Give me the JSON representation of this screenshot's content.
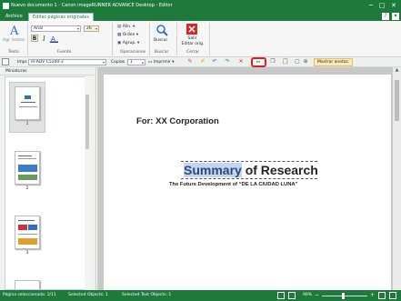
{
  "window": {
    "title": "Nuevo documento 1 - Canon imageRUNNER ADVANCE Desktop - Editor",
    "buttons": {
      "minimize": "─",
      "maximize": "□",
      "close": "✕"
    }
  },
  "tabs": [
    {
      "label": "Archivo"
    },
    {
      "label": "Editar páginas originales"
    }
  ],
  "ribbon": {
    "text_group": {
      "add_text_label": "Agr. textos",
      "group_label": "Texto"
    },
    "font_group": {
      "font_name": "Arial",
      "font_size": "26",
      "bold": "B",
      "group_label": "Fuente"
    },
    "operations_group": {
      "align_label": "Alin.",
      "order_label": "Orden",
      "group_label_btn": "Agrup.",
      "group_label": "Operaciones"
    },
    "search_group": {
      "search_label": "Buscar",
      "group_label": "Buscar"
    },
    "close_group": {
      "exit_label_1": "Salir",
      "exit_label_2": "Editar orig.",
      "group_label": "Cerrar"
    }
  },
  "toolbar2": {
    "printer_label": "Impr.",
    "printer_value": "iR-ADV C5240-3",
    "copies_label": "Copias",
    "copies_value": "1",
    "print_label": "Imprimir",
    "show_annotations_label": "Mostrar anotac."
  },
  "sidebar": {
    "title": "Miniaturas",
    "pages": [
      "1",
      "2",
      "3"
    ]
  },
  "document": {
    "for_line": "For: XX Corporation",
    "title_highlight": "Summary",
    "title_rest": " of Research",
    "subtitle": "The Future Development of “DE LA CIUDAD LUNA”"
  },
  "status": {
    "pages_selected": "Página seleccionada: 1/11",
    "selected_objects": "Selected Objects: 1",
    "selected_text_objects": "Selected Text Objects: 1",
    "zoom": "90%"
  },
  "colors": {
    "brand": "#1d7a3a",
    "highlight": "#c5d5ef",
    "close_red": "#d12b2b"
  }
}
